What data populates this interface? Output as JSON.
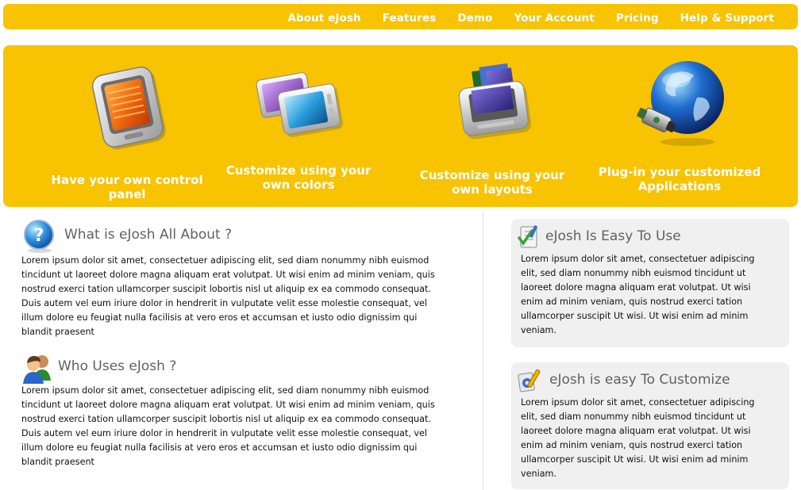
{
  "nav": {
    "items": [
      "About eJosh",
      "Features",
      "Demo",
      "Your Account",
      "Pricing",
      "Help & Support"
    ]
  },
  "banner": {
    "features": [
      {
        "caption": "Have your own control panel",
        "icon": "control-panel-icon"
      },
      {
        "caption": "Customize using your own colors",
        "icon": "colors-icon"
      },
      {
        "caption": "Customize using your own layouts",
        "icon": "layouts-icon"
      },
      {
        "caption": "Plug-in your customized Applications",
        "icon": "globe-plugin-icon"
      }
    ]
  },
  "main": {
    "about": {
      "title": "What is eJosh All About ?",
      "icon": "question-icon",
      "body": "Lorem ipsum dolor sit amet, consectetuer adipiscing elit, sed diam nonummy nibh euismod tincidunt ut laoreet dolore magna aliquam erat volutpat. Ut wisi enim ad minim veniam, quis nostrud exerci tation ullamcorper suscipit lobortis nisl ut aliquip ex ea commodo consequat. Duis autem vel eum iriure dolor in hendrerit in vulputate velit esse molestie consequat, vel illum dolore eu feugiat nulla facilisis at vero eros et accumsan et iusto odio dignissim qui blandit praesent"
    },
    "users": {
      "title": "Who Uses eJosh ?",
      "icon": "users-icon",
      "body": "Lorem ipsum dolor sit amet, consectetuer adipiscing elit, sed diam nonummy nibh euismod tincidunt ut laoreet dolore magna aliquam erat volutpat. Ut wisi enim ad minim veniam, quis nostrud exerci tation ullamcorper suscipit lobortis nisl ut aliquip ex ea commodo consequat. Duis autem vel eum iriure dolor in hendrerit in vulputate velit esse molestie consequat, vel illum dolore eu feugiat nulla facilisis at vero eros et accumsan et iusto odio dignissim qui blandit praesent"
    }
  },
  "sidebar": {
    "easy_use": {
      "title": "eJosh Is Easy To Use",
      "icon": "checklist-icon",
      "body": "Lorem ipsum dolor sit amet, consectetuer adipiscing elit, sed diam nonummy nibh euismod tincidunt ut laoreet dolore magna aliquam erat volutpat. Ut wisi enim ad minim veniam, quis nostrud exerci tation ullamcorper suscipit Ut wisi. Ut wisi enim ad minim veniam."
    },
    "easy_customize": {
      "title": "eJosh is easy To Customize",
      "icon": "tools-icon",
      "body": "Lorem ipsum dolor sit amet, consectetuer adipiscing elit, sed diam nonummy nibh euismod tincidunt ut laoreet dolore magna aliquam erat volutpat. Ut wisi enim ad minim veniam, quis nostrud exerci tation ullamcorper suscipit Ut wisi. Ut wisi enim ad minim veniam."
    }
  }
}
